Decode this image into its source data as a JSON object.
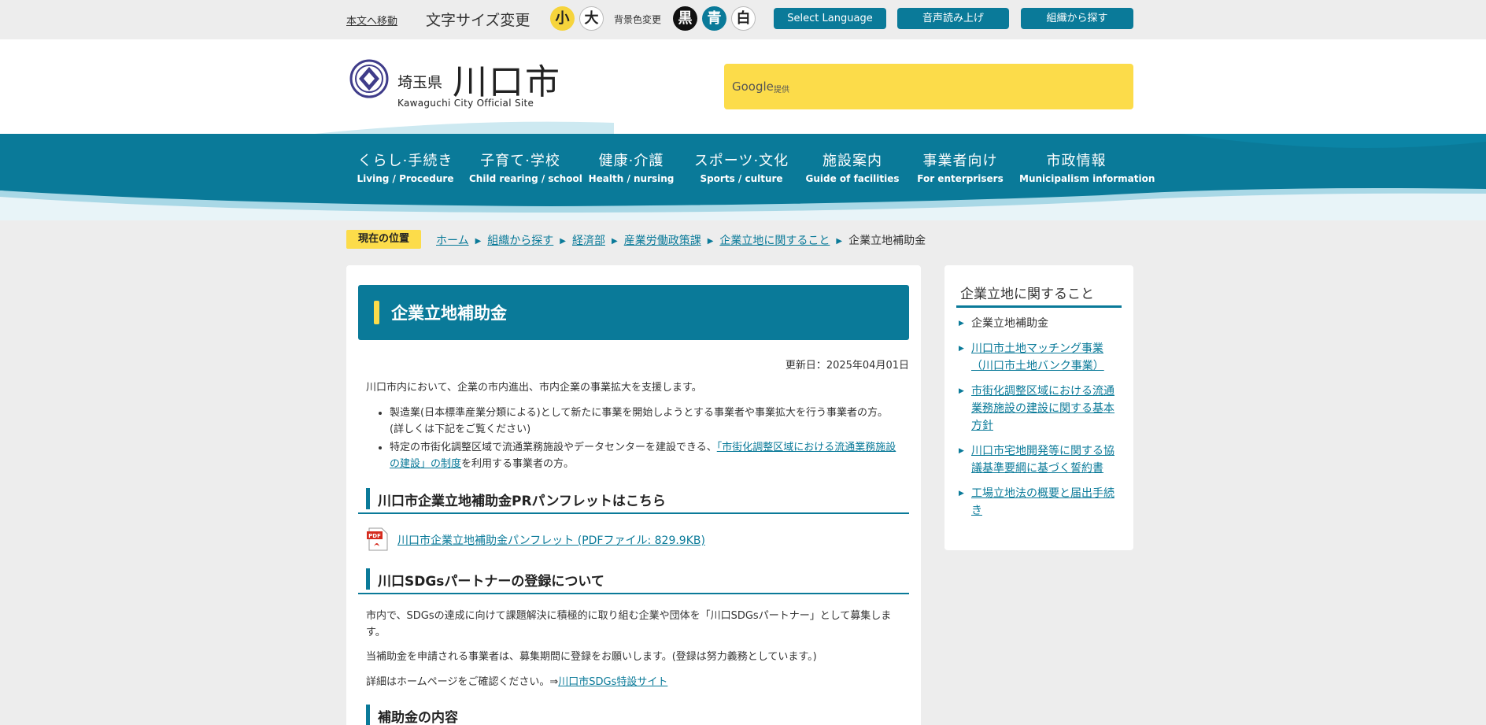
{
  "utility": {
    "skip_link": "本文へ移動",
    "font_size_label": "文字サイズ変更",
    "font_small": "小",
    "font_large": "大",
    "bg_color_label": "背景色変更",
    "bg_black": "黒",
    "bg_blue": "青",
    "bg_white": "白",
    "select_language": "Select Language",
    "voice_read": "音声読み上げ",
    "search_by_org": "組織から探す"
  },
  "header": {
    "pref": "埼玉県",
    "city": "川口市",
    "site_en": "Kawaguchi City Official Site",
    "search_brand": "Google",
    "search_provided": "提供"
  },
  "nav": [
    {
      "jp": "くらし·手続き",
      "en": "Living / Procedure"
    },
    {
      "jp": "子育て·学校",
      "en": "Child rearing / school"
    },
    {
      "jp": "健康·介護",
      "en": "Health / nursing"
    },
    {
      "jp": "スポーツ·文化",
      "en": "Sports / culture"
    },
    {
      "jp": "施設案内",
      "en": "Guide of facilities"
    },
    {
      "jp": "事業者向け",
      "en": "For enterprisers"
    },
    {
      "jp": "市政情報",
      "en": "Municipalism  information"
    }
  ],
  "breadcrumb": {
    "label": "現在の位置",
    "items": [
      "ホーム",
      "組織から探す",
      "経済部",
      "産業労働政策課",
      "企業立地に関すること"
    ],
    "current": "企業立地補助金"
  },
  "main": {
    "title": "企業立地補助金",
    "updated": "更新日：2025年04月01日",
    "lead": "川口市内において、企業の市内進出、市内企業の事業拡大を支援します。",
    "bullet1": "製造業(日本標準産業分類による)として新たに事業を開始しようとする事業者や事業拡大を行う事業者の方。(詳しくは下記をご覧ください)",
    "bullet2_pre": "特定の市街化調整区域で流通業務施設やデータセンターを建設できる、",
    "bullet2_link": "「市街化調整区域における流通業務施設の建設」の制度",
    "bullet2_post": "を利用する事業者の方。",
    "h_pamphlet": "川口市企業立地補助金PRパンフレットはこちら",
    "pdf_badge": "PDF",
    "pdf_link": "川口市企業立地補助金パンフレット (PDFファイル: 829.9KB)",
    "h_sdgs": "川口SDGsパートナーの登録について",
    "sdgs_p1": "市内で、SDGsの達成に向けて課題解決に積極的に取り組む企業や団体を「川口SDGsパートナー」として募集します。",
    "sdgs_p2": "当補助金を申請される事業者は、募集期間に登録をお願いします。(登録は努力義務としています。)",
    "sdgs_p3_pre": "詳細はホームページをご確認ください。⇒",
    "sdgs_p3_link": "川口市SDGs特設サイト",
    "h_content": "補助金の内容"
  },
  "side": {
    "title": "企業立地に関すること",
    "items": [
      "企業立地補助金",
      "川口市土地マッチング事業（川口市土地バンク事業）",
      "市街化調整区域における流通業務施設の建設に関する基本方針",
      "川口市宅地開発等に関する協議基準要綱に基づく誓約書",
      "工場立地法の概要と届出手続き"
    ]
  },
  "colors": {
    "accent": "#0a7a99",
    "highlight": "#fcdc4a",
    "background": "#ededed"
  }
}
